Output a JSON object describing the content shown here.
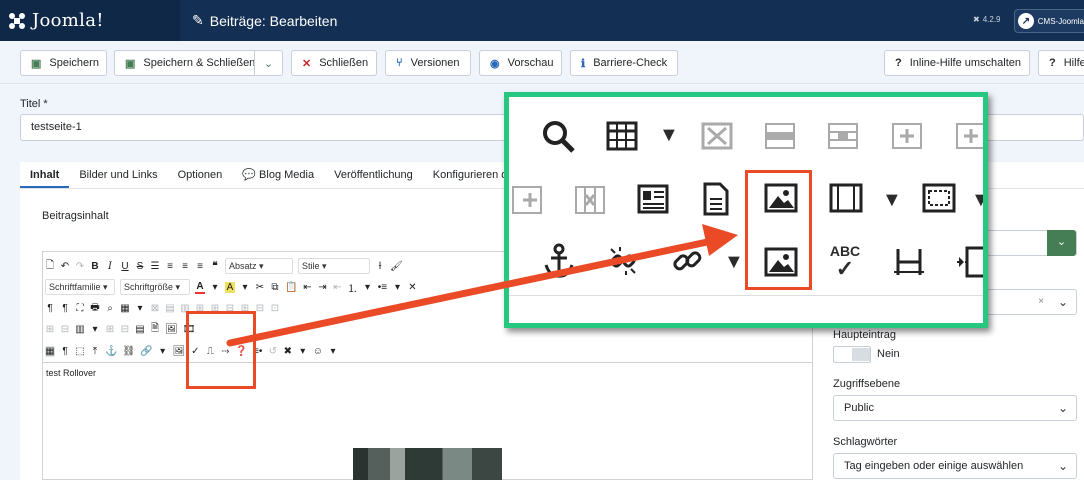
{
  "header": {
    "logo_text": "Joomla!",
    "page_title": "Beiträge: Bearbeiten",
    "version": "4.2.9",
    "site_button": "CMS-Joomla"
  },
  "toolbar": {
    "save": "Speichern",
    "save_close": "Speichern & Schließen",
    "close": "Schließen",
    "versions": "Versionen",
    "preview": "Vorschau",
    "a11y_check": "Barriere-Check",
    "inline_help": "Inline-Hilfe umschalten",
    "help": "Hilfe"
  },
  "form": {
    "title_label": "Titel *",
    "title_value": "testseite-1",
    "content_label": "Beitragsinhalt"
  },
  "tabs": [
    "Inhalt",
    "Bilder und Links",
    "Optionen",
    "Blog Media",
    "Veröffentlichung",
    "Konfigurieren des Ed"
  ],
  "editor": {
    "format_select": "Absatz",
    "style_select": "Stile",
    "font_family": "Schriftfamilie",
    "font_size": "Schriftgröße",
    "content_text": "test Rollover"
  },
  "sidebar": {
    "featured_label": "Haupteintrag",
    "featured_value": "Nein",
    "access_label": "Zugriffsebene",
    "access_value": "Public",
    "tags_label": "Schlagwörter",
    "tags_placeholder": "Tag eingeben oder einige auswählen"
  },
  "colors": {
    "topbar": "#132f53",
    "highlight_green": "#25c87e",
    "highlight_red": "#ea4a25",
    "select_button_green": "#457d54"
  },
  "zoom_icons": {
    "row1": [
      "search-icon",
      "table-icon",
      "dropdown-arrow-icon",
      "delete-table-icon",
      "table-row-icon",
      "table-row-props-icon",
      "insert-row-before-icon",
      "insert-row-after-icon"
    ],
    "row2": [
      "insert-column-icon",
      "delete-column-icon",
      "contact-card-icon",
      "document-icon",
      "image-icon",
      "media-icon",
      "dropdown-arrow-icon",
      "template-icon"
    ],
    "row3": [
      "anchor-icon",
      "unlink-icon",
      "link-icon",
      "dropdown-arrow-icon",
      "image-rollover-icon",
      "spellcheck-icon",
      "nonbreaking-icon",
      "page-break-icon"
    ],
    "spellcheck_text": "ABC"
  }
}
